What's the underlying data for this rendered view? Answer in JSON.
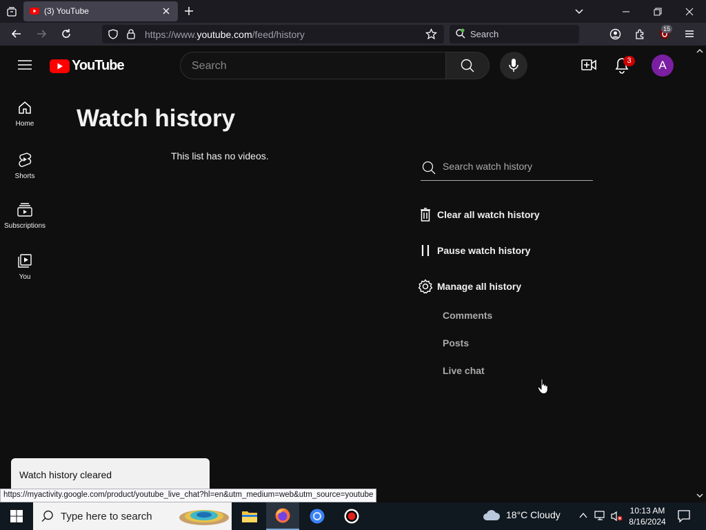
{
  "browser": {
    "tab_title": "(3) YouTube",
    "url_prefix": "https://www.",
    "url_domain": "youtube.com",
    "url_path": "/feed/history",
    "search_placeholder": "Search",
    "extension_badge": "15",
    "status_url": "https://myactivity.google.com/product/youtube_live_chat?hl=en&utm_medium=web&utm_source=youtube"
  },
  "masthead": {
    "logo_text": "YouTube",
    "search_placeholder": "Search",
    "notification_count": "3",
    "avatar_letter": "A"
  },
  "guide": {
    "items": [
      {
        "label": "Home",
        "icon": "home-icon"
      },
      {
        "label": "Shorts",
        "icon": "shorts-icon"
      },
      {
        "label": "Subscriptions",
        "icon": "subscriptions-icon"
      },
      {
        "label": "You",
        "icon": "you-icon"
      }
    ]
  },
  "main": {
    "title": "Watch history",
    "empty_message": "This list has no videos."
  },
  "history_panel": {
    "search_placeholder": "Search watch history",
    "actions": [
      {
        "label": "Clear all watch history",
        "icon": "trash-icon"
      },
      {
        "label": "Pause watch history",
        "icon": "pause-icon"
      },
      {
        "label": "Manage all history",
        "icon": "gear-icon"
      }
    ],
    "sub_links": [
      "Comments",
      "Posts",
      "Live chat"
    ]
  },
  "toast": {
    "message": "Watch history cleared"
  },
  "taskbar": {
    "search_placeholder": "Type here to search",
    "weather": "18°C  Cloudy",
    "time": "10:13 AM",
    "date": "8/16/2024"
  },
  "colors": {
    "youtube_red": "#ff0000",
    "page_background": "#0f0f0f",
    "avatar": "#7b1fa2",
    "badge_red": "#cc0000"
  }
}
